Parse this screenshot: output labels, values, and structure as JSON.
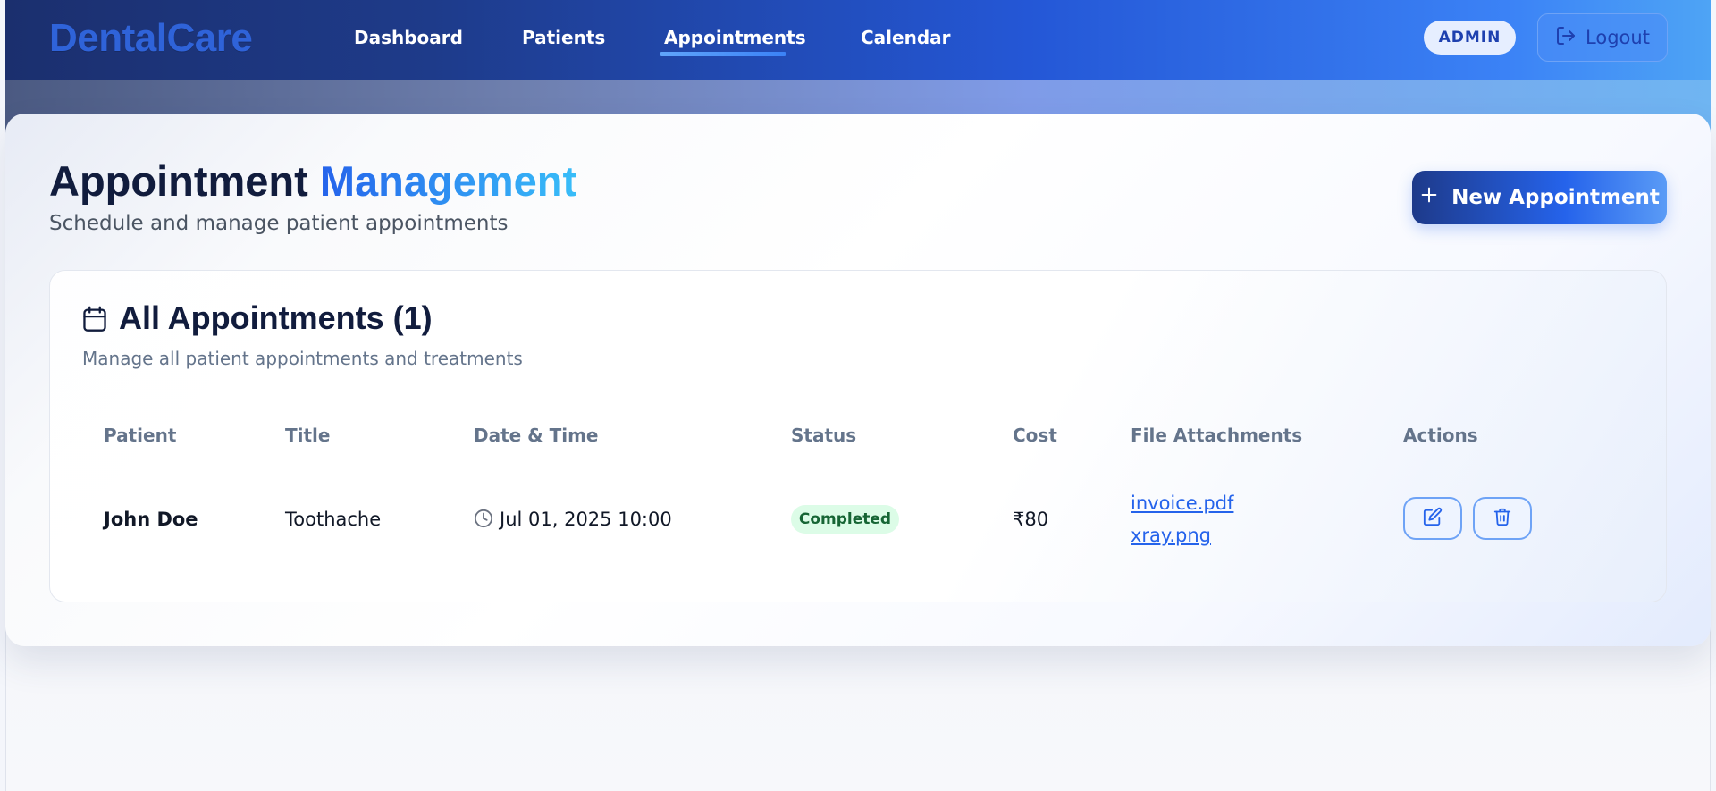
{
  "nav": {
    "brand": "DentalCare",
    "links": [
      "Dashboard",
      "Patients",
      "Appointments",
      "Calendar"
    ],
    "active": "Appointments",
    "role_badge": "ADMIN",
    "logout_label": "Logout"
  },
  "page": {
    "title_main": "Appointment ",
    "title_accent": "Management",
    "subtitle": "Schedule and manage patient appointments",
    "new_button_label": "New Appointment"
  },
  "appointments": {
    "title": "All Appointments (1)",
    "subtitle": "Manage all patient appointments and treatments",
    "columns": [
      "Patient",
      "Title",
      "Date & Time",
      "Status",
      "Cost",
      "File Attachments",
      "Actions"
    ],
    "rows": [
      {
        "patient": "John Doe",
        "title": "Toothache",
        "datetime": "Jul 01, 2025 10:00",
        "status": "Completed",
        "cost": "₹80",
        "files": [
          "invoice.pdf",
          "xray.png"
        ]
      }
    ]
  },
  "colors": {
    "accent": "#2563eb",
    "status_completed_bg": "#dcfce7",
    "status_completed_text": "#166534"
  },
  "icons": [
    "logout-icon",
    "plus-icon",
    "calendar-icon",
    "clock-icon",
    "edit-icon",
    "trash-icon"
  ]
}
